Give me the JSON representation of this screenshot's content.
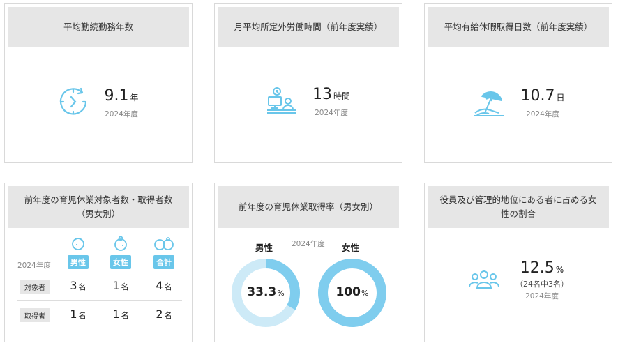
{
  "cards": {
    "tenure": {
      "title": "平均勤続勤務年数",
      "value": "9.1",
      "unit": "年",
      "year": "2024年度"
    },
    "overtime": {
      "title": "月平均所定外労働時間（前年度実績）",
      "value": "13",
      "unit": "時間",
      "year": "2024年度"
    },
    "leave": {
      "title": "平均有給休暇取得日数（前年度実績）",
      "value": "10.7",
      "unit": "日",
      "year": "2024年度"
    },
    "childcare_counts": {
      "title_line1": "前年度の育児休業対象者数・取得者数",
      "title_line2": "（男女別）",
      "year": "2024年度",
      "columns": [
        "男性",
        "女性",
        "合計"
      ],
      "rows": [
        {
          "label": "対象者",
          "values": [
            "3",
            "1",
            "4"
          ]
        },
        {
          "label": "取得者",
          "values": [
            "1",
            "1",
            "2"
          ]
        }
      ],
      "unit": "名"
    },
    "childcare_rate": {
      "title": "前年度の育児休業取得率（男女別）",
      "year": "2024年度",
      "male": {
        "label": "男性",
        "value": "33.3",
        "pct": 33.3
      },
      "female": {
        "label": "女性",
        "value": "100",
        "pct": 100
      },
      "unit": "%"
    },
    "women_managers": {
      "title_line1": "役員及び管理的地位にある者に占める女",
      "title_line2": "性の割合",
      "value": "12.5",
      "unit": "%",
      "detail": "（24名中3名）",
      "year": "2024年度"
    }
  },
  "colors": {
    "accent": "#69c6ea",
    "donut_track": "#cdeaf7",
    "donut_fill": "#7fcdee"
  }
}
